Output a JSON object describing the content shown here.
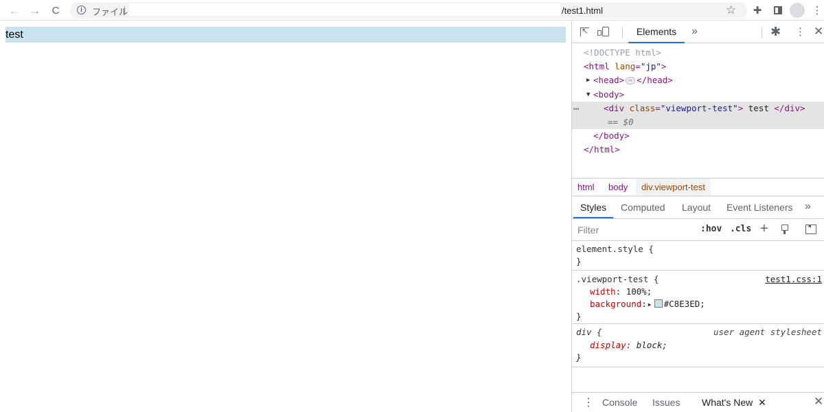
{
  "browser": {
    "back_icon": "←",
    "forward_icon": "→",
    "reload_icon": "C",
    "info_icon": "i",
    "scheme_label": "ファイル",
    "omnibox_separator": "|",
    "url": "/test1.html",
    "star_icon": "☆",
    "extensions_icon": "✚",
    "menu_icon": "⋮"
  },
  "page": {
    "div_text": "test",
    "div_background": "#C8E3ED"
  },
  "devtools": {
    "tabs": {
      "elements": "Elements",
      "more": "»"
    },
    "settings_icon": "✱",
    "kebab_icon": "⋮",
    "close_icon": "✕",
    "dom": {
      "doctype": "<!DOCTYPE html>",
      "html_open_tag": "<html",
      "html_attr_name": "lang",
      "html_attr_value": "\"jp\"",
      "html_close_bracket": ">",
      "head_open": "<head>",
      "head_close": "</head>",
      "ellipsis": "⋯",
      "body_open": "<body>",
      "div_open_tag": "<div",
      "div_attr_name": "class",
      "div_attr_value": "\"viewport-test\"",
      "div_close_bracket": ">",
      "div_text": " test ",
      "div_close": "</div>",
      "selected_marker": "== $0",
      "row_dots": "⋯",
      "body_close": "</body>",
      "html_close": "</html>"
    },
    "breadcrumbs": [
      "html",
      "body",
      "div.viewport-test"
    ],
    "style_tabs": [
      "Styles",
      "Computed",
      "Layout",
      "Event Listeners"
    ],
    "style_tabs_more": "»",
    "filter": {
      "placeholder": "Filter",
      "hov": ":hov",
      "cls": ".cls",
      "plus": "+"
    },
    "rules": {
      "element_style": {
        "selector": "element.style {",
        "close": "}"
      },
      "viewport_test": {
        "selector": ".viewport-test {",
        "source": "test1.css:1",
        "props": [
          {
            "name": "width",
            "value": "100%;"
          },
          {
            "name": "background",
            "value": "#C8E3ED;"
          }
        ],
        "close": "}"
      },
      "div_ua": {
        "selector": "div {",
        "source": "user agent stylesheet",
        "props": [
          {
            "name": "display",
            "value": "block;"
          }
        ],
        "close": "}"
      }
    },
    "drawer": {
      "menu_icon": "⋮",
      "tabs": [
        "Console",
        "Issues",
        "What's New"
      ],
      "tab_close_icon": "✕",
      "close_icon": "✕"
    }
  }
}
